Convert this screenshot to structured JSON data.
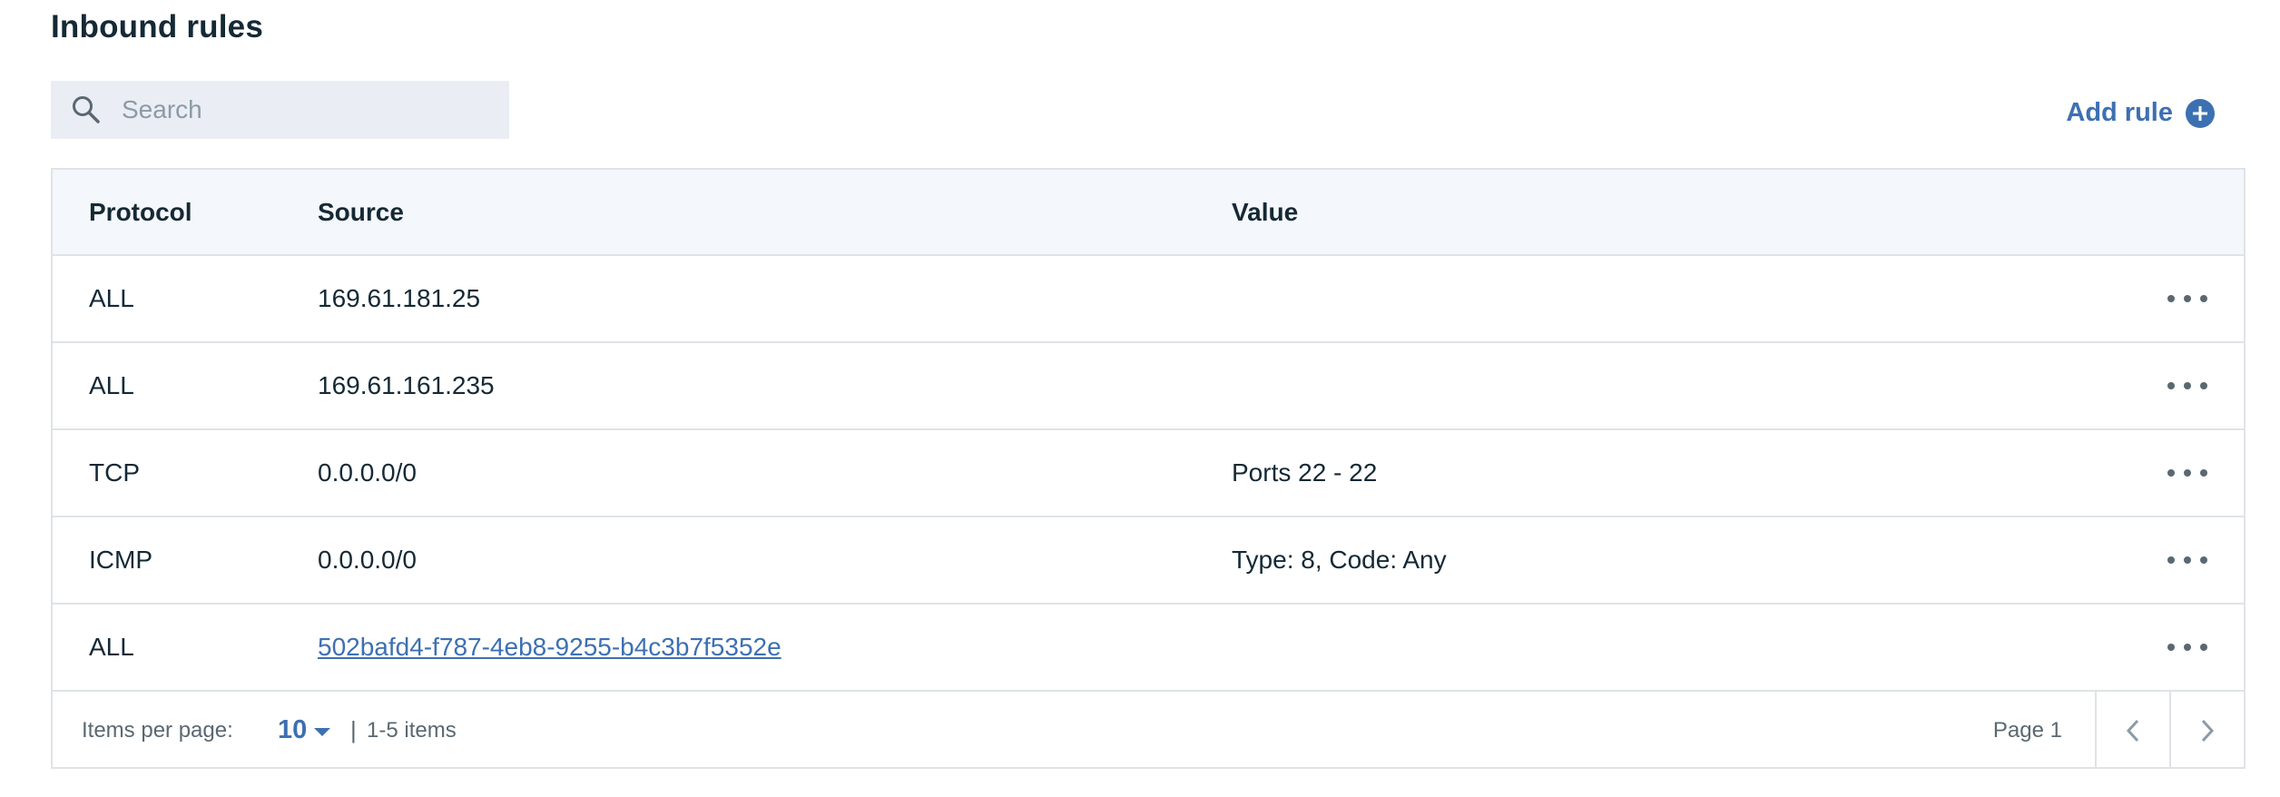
{
  "page": {
    "title": "Inbound rules"
  },
  "search": {
    "placeholder": "Search",
    "value": ""
  },
  "actions": {
    "add_rule_label": "Add rule"
  },
  "table": {
    "columns": [
      "Protocol",
      "Source",
      "Value"
    ],
    "rows": [
      {
        "protocol": "ALL",
        "source": "169.61.181.25",
        "value": "",
        "source_is_link": false
      },
      {
        "protocol": "ALL",
        "source": "169.61.161.235",
        "value": "",
        "source_is_link": false
      },
      {
        "protocol": "TCP",
        "source": "0.0.0.0/0",
        "value": "Ports 22 - 22",
        "source_is_link": false
      },
      {
        "protocol": "ICMP",
        "source": "0.0.0.0/0",
        "value": "Type: 8, Code: Any",
        "source_is_link": false
      },
      {
        "protocol": "ALL",
        "source": "502bafd4-f787-4eb8-9255-b4c3b7f5352e",
        "value": "",
        "source_is_link": true
      }
    ]
  },
  "pagination": {
    "items_per_page_label": "Items per page:",
    "items_per_page_value": "10",
    "separator": "|",
    "range_label": "1-5 items",
    "page_label": "Page 1"
  },
  "colors": {
    "accent": "#3d70b2",
    "text": "#152935",
    "muted": "#5a6872",
    "border": "#dfe3e6",
    "header_bg": "#f4f7fb",
    "search_bg": "#eaeef4"
  },
  "icons": {
    "search": "search-icon",
    "add": "add-circle-icon",
    "overflow": "overflow-menu-icon",
    "caret": "caret-down-icon",
    "prev": "chevron-left-icon",
    "next": "chevron-right-icon"
  }
}
